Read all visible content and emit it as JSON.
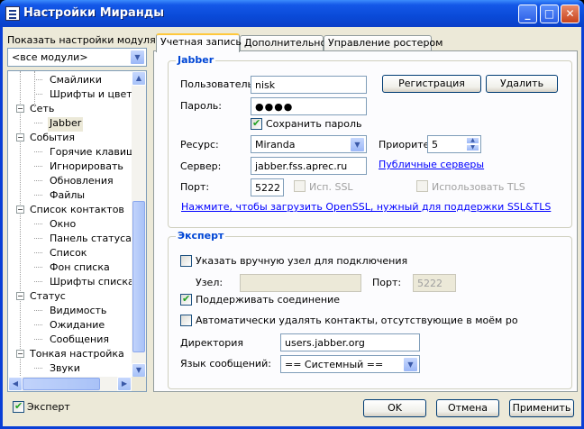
{
  "window": {
    "title": "Настройки Миранды",
    "buttons": {
      "minimize": "_",
      "maximize": "□",
      "close": "✕"
    }
  },
  "sidebar": {
    "module_label": "Показать настройки модуля:",
    "module_select": "<все модули>",
    "tree": [
      {
        "label": "Смайлики",
        "level": 2
      },
      {
        "label": "Шрифты и цвета",
        "level": 2
      },
      {
        "label": "Сеть",
        "level": 1,
        "toggle": "−"
      },
      {
        "label": "Jabber",
        "level": 2,
        "selected": true
      },
      {
        "label": "События",
        "level": 1,
        "toggle": "−"
      },
      {
        "label": "Горячие клавиши",
        "level": 2
      },
      {
        "label": "Игнорировать",
        "level": 2
      },
      {
        "label": "Обновления",
        "level": 2
      },
      {
        "label": "Файлы",
        "level": 2
      },
      {
        "label": "Список контактов",
        "level": 1,
        "toggle": "−"
      },
      {
        "label": "Окно",
        "level": 2
      },
      {
        "label": "Панель статуса",
        "level": 2
      },
      {
        "label": "Список",
        "level": 2
      },
      {
        "label": "Фон списка",
        "level": 2
      },
      {
        "label": "Шрифты списка",
        "level": 2
      },
      {
        "label": "Статус",
        "level": 1,
        "toggle": "−"
      },
      {
        "label": "Видимость",
        "level": 2
      },
      {
        "label": "Ожидание",
        "level": 2
      },
      {
        "label": "Сообщения",
        "level": 2
      },
      {
        "label": "Тонкая настройка",
        "level": 1,
        "toggle": "−"
      },
      {
        "label": "Звуки",
        "level": 2
      }
    ]
  },
  "tabs": [
    {
      "label": "Учетная запись",
      "active": true
    },
    {
      "label": "Дополнительно",
      "active": false
    },
    {
      "label": "Управление ростером",
      "active": false
    }
  ],
  "jabber": {
    "group_title": "Jabber",
    "user_label": "Пользователь",
    "user_value": "nisk",
    "password_label": "Пароль:",
    "password_value": "●●●●",
    "register_button": "Регистрация",
    "delete_button": "Удалить",
    "save_password_label": "Сохранить пароль",
    "save_password_checked": true,
    "resource_label": "Ресурс:",
    "resource_value": "Miranda",
    "priority_label": "Приорите",
    "priority_value": "5",
    "server_label": "Сервер:",
    "server_value": "jabber.fss.aprec.ru",
    "public_servers_link": "Публичные серверы",
    "port_label": "Порт:",
    "port_value": "5222",
    "ssl_label": "Исп. SSL",
    "tls_label": "Использовать TLS",
    "openssl_link": "Нажмите, чтобы загрузить OpenSSL, нужный для поддержки SSL&TLS"
  },
  "expert": {
    "group_title": "Эксперт",
    "manual_host_label": "Указать вручную узел для подключения",
    "manual_host_checked": false,
    "host_label": "Узел:",
    "host_value": "",
    "port_label": "Порт:",
    "port_value": "5222",
    "keepalive_label": "Поддерживать соединение",
    "keepalive_checked": true,
    "autodelete_label": "Автоматически удалять контакты, отсутствующие в моём ро",
    "autodelete_checked": false,
    "directory_label": "Директория",
    "directory_value": "users.jabber.org",
    "language_label": "Язык сообщений:",
    "language_value": "== Системный =="
  },
  "footer": {
    "expert_label": "Эксперт",
    "expert_checked": true,
    "ok_button": "OK",
    "cancel_button": "Отмена",
    "apply_button": "Применить"
  }
}
